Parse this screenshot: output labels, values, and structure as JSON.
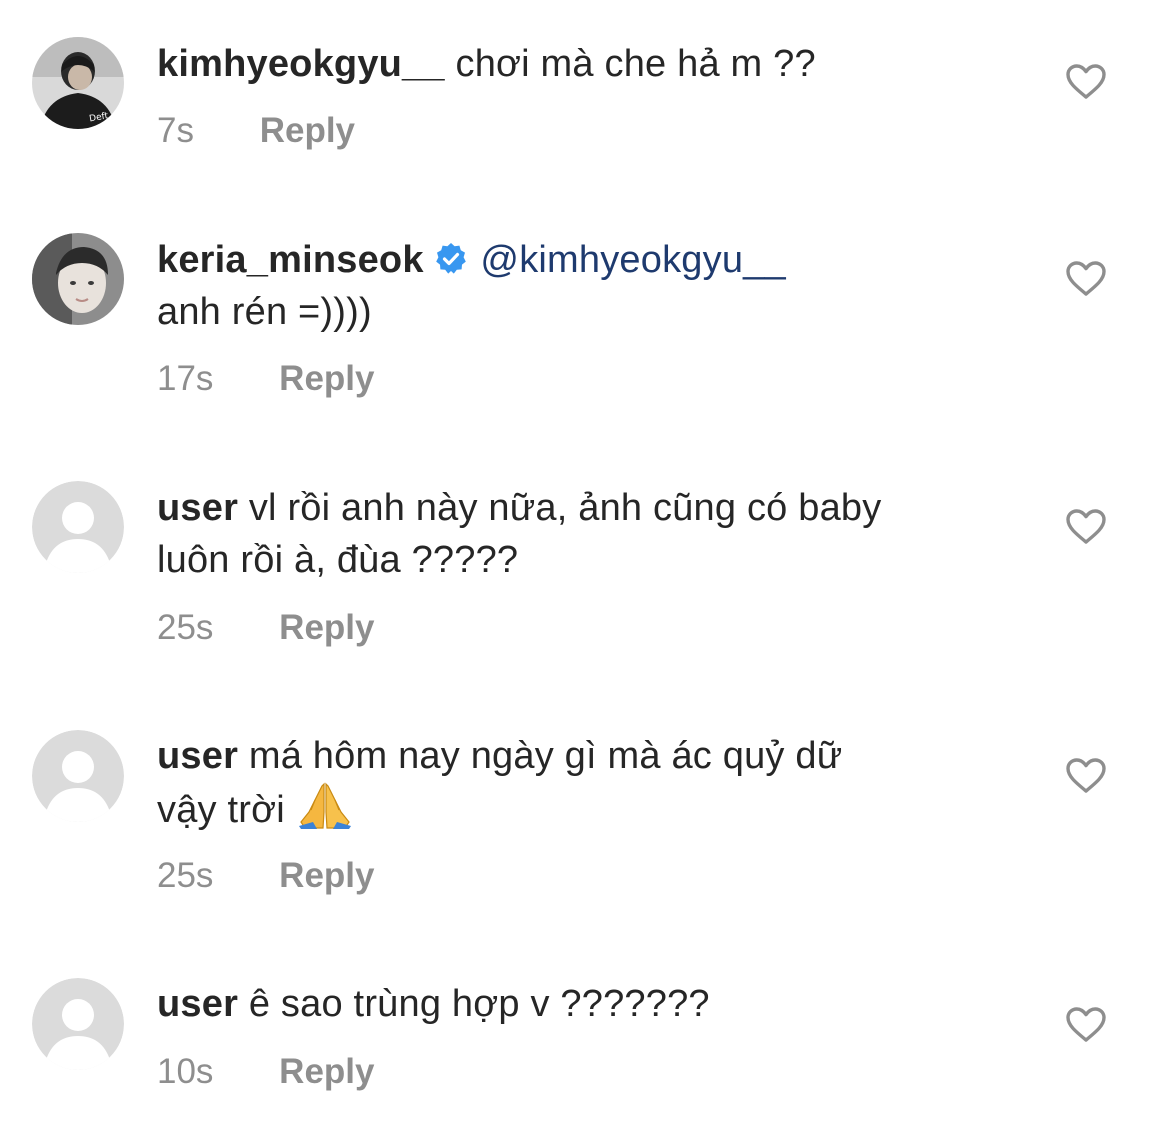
{
  "comments": [
    {
      "username": "kimhyeokgyu__",
      "text": "chơi mà che hả m ??",
      "time": "7s",
      "reply_label": "Reply",
      "avatar_label": "Deft",
      "avatar_type": "photo-dark"
    },
    {
      "username": "keria_minseok",
      "verified": true,
      "mention": "@kimhyeokgyu__",
      "text": "anh rén =))))",
      "time": "17s",
      "reply_label": "Reply",
      "avatar_type": "photo-light"
    },
    {
      "username": "user",
      "text": "vl rồi anh này nữa, ảnh cũng có baby",
      "text_line2": "luôn rồi à, đùa ?????",
      "time": "25s",
      "reply_label": "Reply",
      "avatar_type": "default"
    },
    {
      "username": "user",
      "text": "má hôm nay ngày gì mà ác quỷ dữ",
      "text_line2": "vậy trời",
      "emoji": "folded-hands-icon",
      "time": "25s",
      "reply_label": "Reply",
      "avatar_type": "default"
    },
    {
      "username": "user",
      "text": "ê sao trùng hợp v ???????",
      "time": "10s",
      "reply_label": "Reply",
      "avatar_type": "default"
    }
  ],
  "icons": {
    "like": "heart-outline-icon",
    "verified": "verified-badge-icon"
  },
  "colors": {
    "text": "#262626",
    "secondary": "#8e8e8e",
    "mention": "#1e3a6e",
    "verified": "#3897f0",
    "default_avatar_bg": "#dbdbdb"
  }
}
